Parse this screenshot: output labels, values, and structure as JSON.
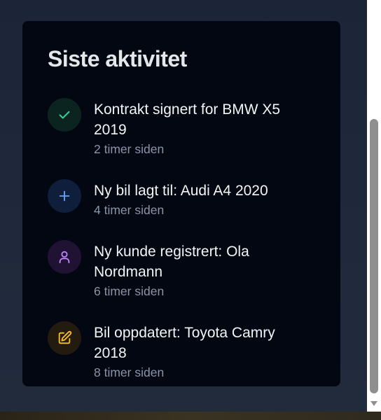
{
  "card": {
    "title": "Siste aktivitet"
  },
  "activities": [
    {
      "title": "Kontrakt signert for BMW X5 2019",
      "time": "2 timer siden",
      "icon": "check-icon",
      "icon_color": "#34d399",
      "icon_bg": "#0b2420"
    },
    {
      "title": "Ny bil lagt til: Audi A4 2020",
      "time": "4 timer siden",
      "icon": "plus-icon",
      "icon_color": "#60a5fa",
      "icon_bg": "#0f1e3a"
    },
    {
      "title": "Ny kunde registrert: Ola Nordmann",
      "time": "6 timer siden",
      "icon": "user-icon",
      "icon_color": "#c084fc",
      "icon_bg": "#1f1233"
    },
    {
      "title": "Bil oppdatert: Toyota Camry 2018",
      "time": "8 timer siden",
      "icon": "edit-icon",
      "icon_color": "#fbbf24",
      "icon_bg": "#231a10"
    }
  ],
  "colors": {
    "page_background": "#1f293b",
    "card_background": "#030712",
    "title_text": "#e5e7eb",
    "time_text": "#8b95a7"
  }
}
